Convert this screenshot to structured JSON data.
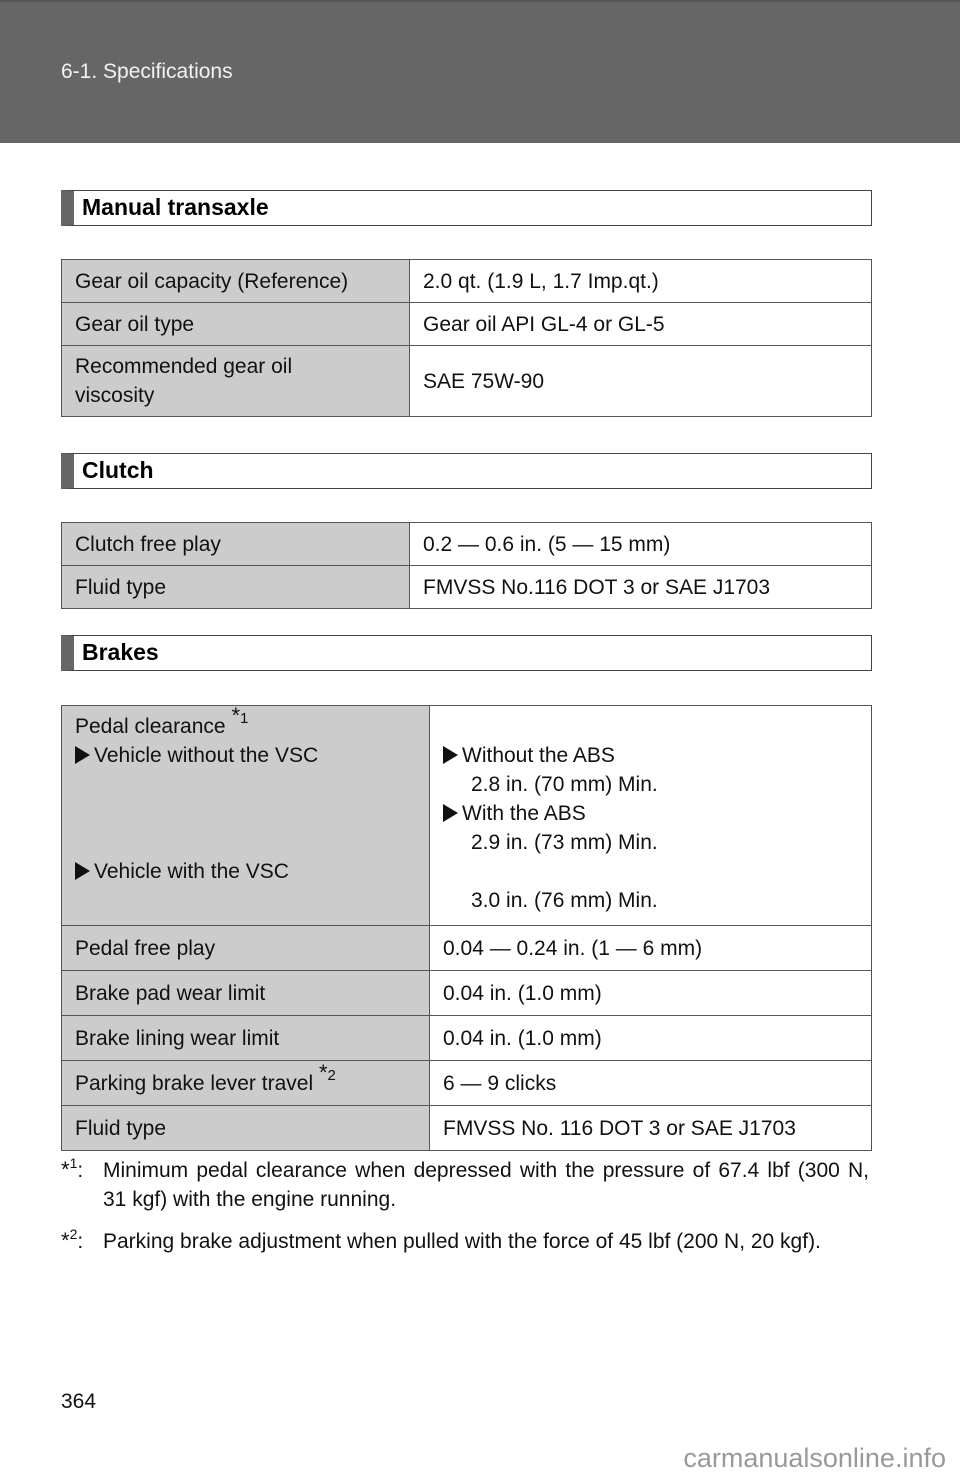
{
  "header": {
    "breadcrumb": "6-1. Specifications"
  },
  "sections": {
    "manual_transaxle": {
      "title": "Manual transaxle",
      "rows": [
        {
          "label": "Gear oil capacity (Reference)",
          "value": "2.0 qt. (1.9 L, 1.7 Imp.qt.)"
        },
        {
          "label": "Gear oil type",
          "value": "Gear oil API GL-4 or GL-5"
        },
        {
          "label_line1": "Recommended gear oil",
          "label_line2": "viscosity",
          "value": "SAE 75W-90"
        }
      ]
    },
    "clutch": {
      "title": "Clutch",
      "rows": [
        {
          "label": "Clutch free play",
          "value": "0.2 — 0.6 in. (5 — 15 mm)"
        },
        {
          "label": "Fluid type",
          "value": "FMVSS No.116 DOT 3 or SAE J1703"
        }
      ]
    },
    "brakes": {
      "title": "Brakes",
      "pedal_clearance": {
        "label": "Pedal clearance",
        "footnote_ref": "*1",
        "without_vsc_label": "Vehicle without the VSC",
        "with_vsc_label": "Vehicle with the VSC",
        "without_abs_label": "Without the ABS",
        "without_abs_value": "2.8 in. (70 mm) Min.",
        "with_abs_label": "With the ABS",
        "with_abs_value": "2.9 in. (73 mm) Min.",
        "with_vsc_value": "3.0 in. (76 mm) Min."
      },
      "rows": [
        {
          "label": "Pedal free play",
          "value": "0.04 — 0.24 in. (1 — 6 mm)"
        },
        {
          "label": "Brake pad wear limit",
          "value": "0.04 in. (1.0 mm)"
        },
        {
          "label": "Brake lining wear limit",
          "value": "0.04 in. (1.0 mm)"
        },
        {
          "label": "Parking brake lever travel",
          "footnote_ref": "*2",
          "value": "6 — 9 clicks"
        },
        {
          "label": "Fluid type",
          "value": "FMVSS No. 116 DOT 3 or SAE J1703"
        }
      ]
    }
  },
  "footnotes": [
    {
      "mark": "*",
      "num": "1",
      "text": "Minimum pedal clearance when depressed with the pressure of 67.4 lbf (300 N, 31 kgf) with the engine running."
    },
    {
      "mark": "*",
      "num": "2",
      "text": "Parking brake adjustment when pulled with the force of 45 lbf (200 N, 20 kgf)."
    }
  ],
  "page_number": "364",
  "watermark": "carmanualsonline.info"
}
